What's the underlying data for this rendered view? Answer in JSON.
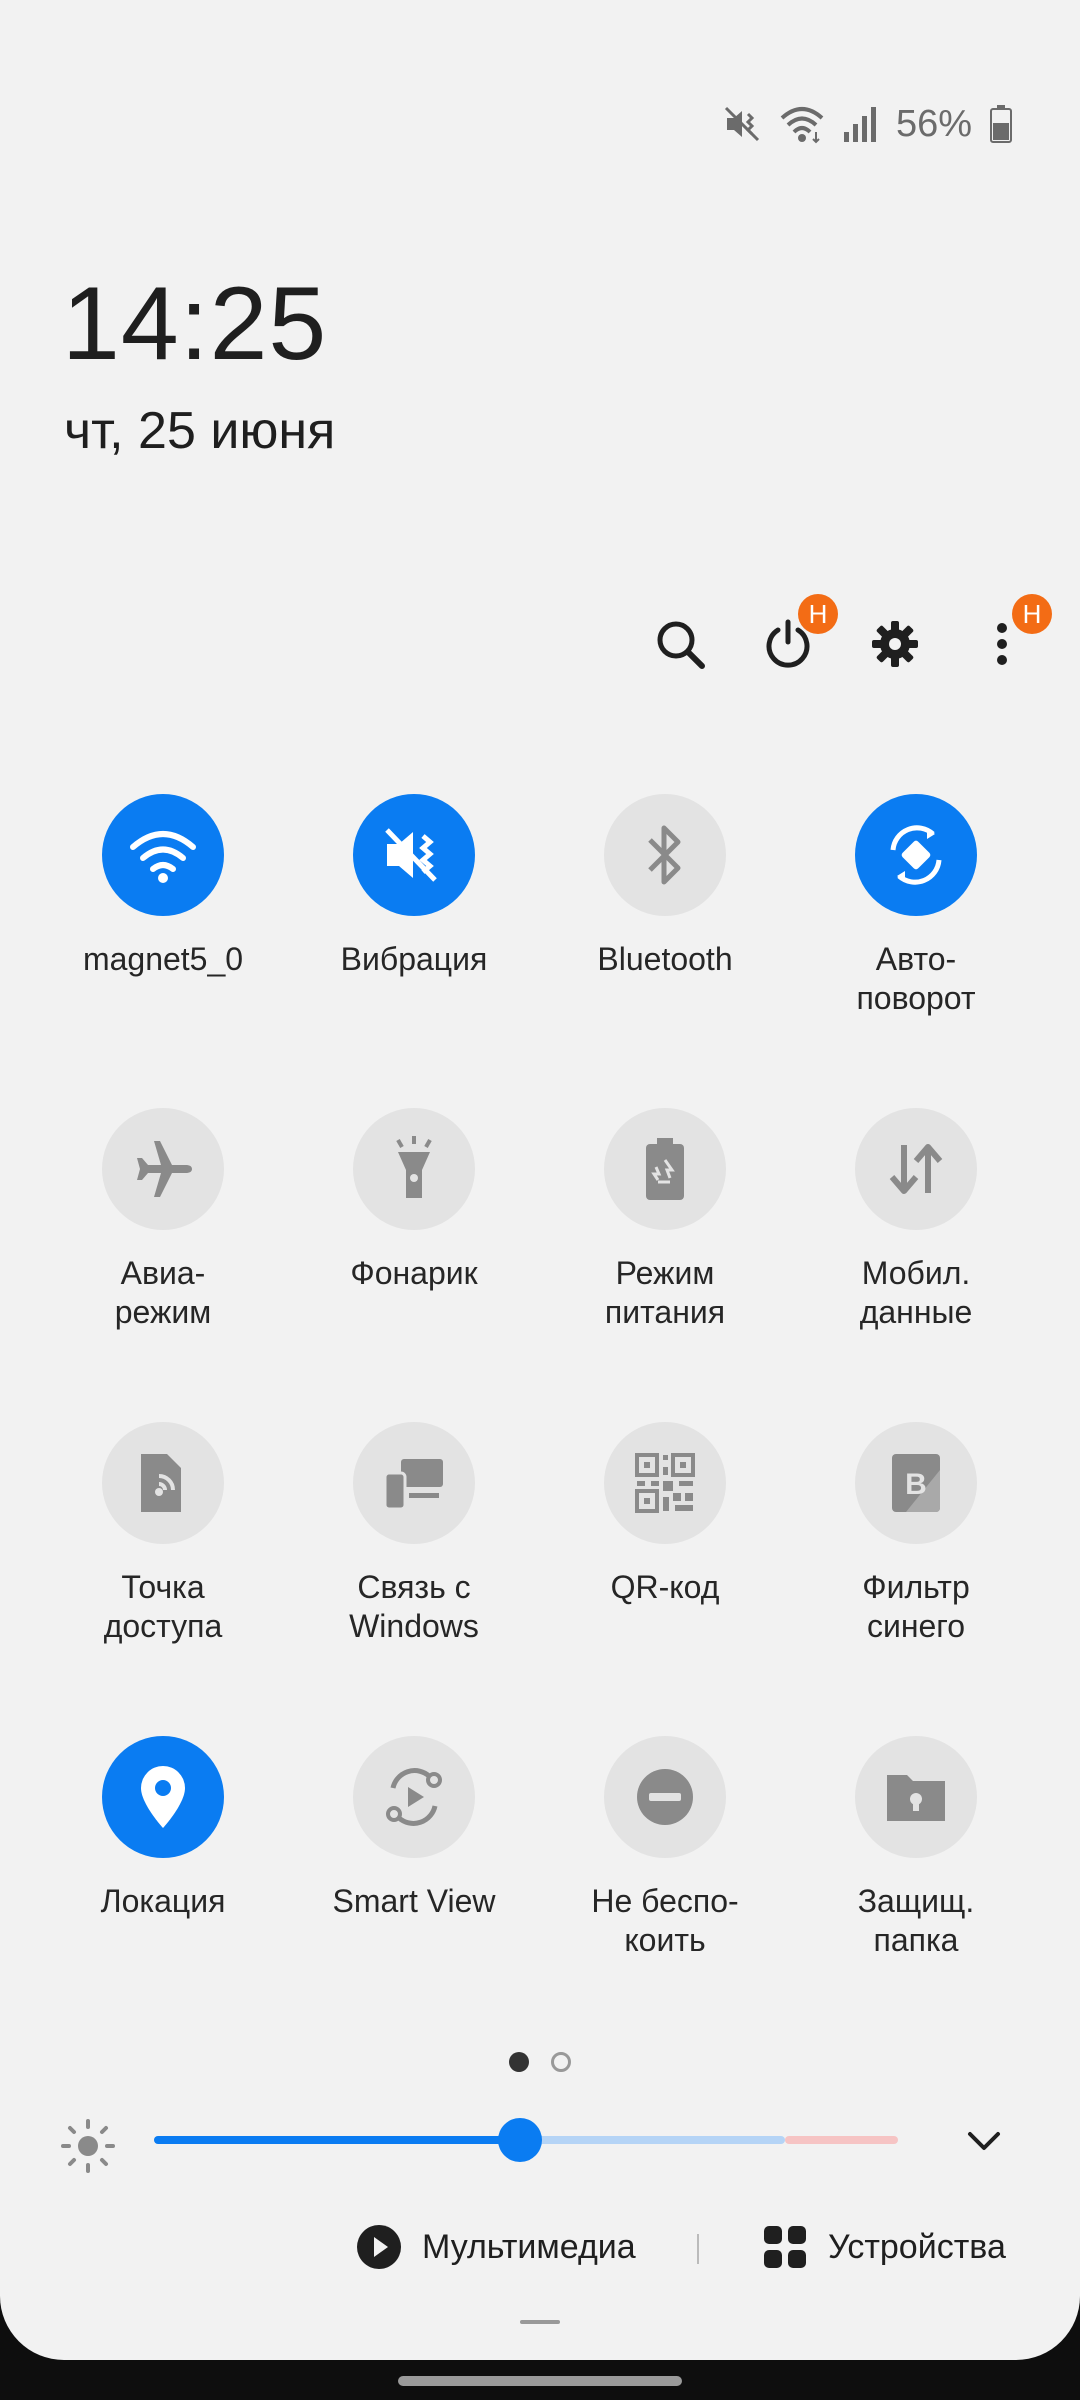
{
  "status_bar": {
    "battery": "56%"
  },
  "clock": {
    "time": "14:25",
    "date": "чт, 25 июня"
  },
  "actions": {
    "power_badge": "H",
    "more_badge": "H"
  },
  "tiles": [
    {
      "label": "magnet5_0",
      "icon": "wifi-icon",
      "on": true
    },
    {
      "label": "Вибрация",
      "icon": "vibrate-icon",
      "on": true
    },
    {
      "label": "Bluetooth",
      "icon": "bluetooth-icon",
      "on": false
    },
    {
      "label": "Авто-\nповорот",
      "icon": "auto-rotate-icon",
      "on": true
    },
    {
      "label": "Авиа-\nрежим",
      "icon": "airplane-icon",
      "on": false
    },
    {
      "label": "Фонарик",
      "icon": "flashlight-icon",
      "on": false
    },
    {
      "label": "Режим\nпитания",
      "icon": "power-mode-icon",
      "on": false
    },
    {
      "label": "Мобил.\nданные",
      "icon": "mobile-data-icon",
      "on": false
    },
    {
      "label": "Точка\nдоступа",
      "icon": "hotspot-icon",
      "on": false
    },
    {
      "label": "Связь с\nWindows",
      "icon": "link-windows-icon",
      "on": false
    },
    {
      "label": "QR-код",
      "icon": "qr-code-icon",
      "on": false
    },
    {
      "label": "Фильтр\nсинего",
      "icon": "blue-filter-icon",
      "on": false
    },
    {
      "label": "Локация",
      "icon": "location-icon",
      "on": true
    },
    {
      "label": "Smart View",
      "icon": "smart-view-icon",
      "on": false
    },
    {
      "label": "Не беспо-\nкоить",
      "icon": "do-not-disturb-icon",
      "on": false
    },
    {
      "label": "Защищ.\nпапка",
      "icon": "secure-folder-icon",
      "on": false
    }
  ],
  "brightness": {
    "level": 0.5
  },
  "bottom": {
    "media_label": "Мультимедиа",
    "devices_label": "Устройства"
  },
  "colors": {
    "accent": "#0a7cf2",
    "badge": "#f36c15",
    "tile_off": "#e3e3e3",
    "icon_off": "#8a8a8a"
  }
}
